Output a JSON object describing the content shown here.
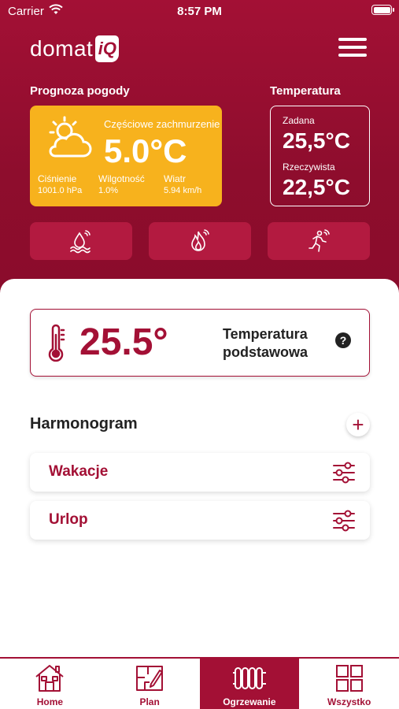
{
  "status_bar": {
    "carrier": "Carrier",
    "time": "8:57 PM"
  },
  "header": {
    "logo_text": "domat",
    "logo_badge": "iQ"
  },
  "weather": {
    "section_title": "Prognoza pogody",
    "condition": "Częściowe zachmurzenie",
    "temperature": "5.0°C",
    "pressure_label": "Ciśnienie",
    "pressure_value": "1001.0 hPa",
    "humidity_label": "Wilgotność",
    "humidity_value": "1.0%",
    "wind_label": "Wiatr",
    "wind_value": "5.94 km/h",
    "card_color": "#f7b21d"
  },
  "temperature": {
    "section_title": "Temperatura",
    "set_label": "Zadana",
    "set_value": "25,5°C",
    "actual_label": "Rzeczywista",
    "actual_value": "22,5°C"
  },
  "quick_actions": [
    {
      "icon": "humidity-wave-icon"
    },
    {
      "icon": "flame-icon"
    },
    {
      "icon": "motion-person-icon"
    }
  ],
  "base_temperature": {
    "value": "25.5°",
    "label_line1": "Temperatura",
    "label_line2": "podstawowa",
    "help": "?"
  },
  "schedule": {
    "title": "Harmonogram",
    "add": "+",
    "items": [
      {
        "label": "Wakacje"
      },
      {
        "label": "Urlop"
      }
    ]
  },
  "tabs": [
    {
      "label": "Home",
      "icon": "home-icon"
    },
    {
      "label": "Plan",
      "icon": "floor-plan-icon"
    },
    {
      "label": "Ogrzewanie",
      "icon": "radiator-icon",
      "active": true
    },
    {
      "label": "Wszystko",
      "icon": "grid-icon"
    }
  ],
  "colors": {
    "brand": "#a31035",
    "accent": "#f7b21d"
  }
}
